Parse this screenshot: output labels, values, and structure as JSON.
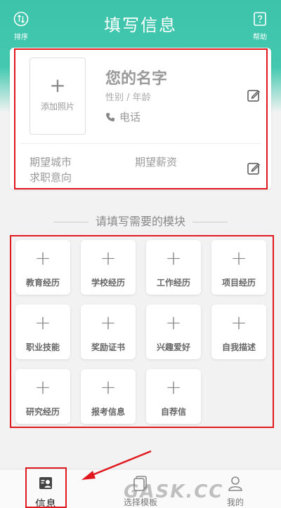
{
  "topbar": {
    "title": "填写信息",
    "sort_label": "排序",
    "help_label": "帮助"
  },
  "profile": {
    "add_photo_label": "添加照片",
    "add_photo_plus": "+",
    "name_placeholder": "您的名字",
    "gender_age": "性别 / 年龄",
    "phone_label": "电话",
    "expected_city": "期望城市",
    "expected_salary": "期望薪资",
    "job_intention": "求职意向"
  },
  "modules": {
    "section_title": "请填写需要的模块",
    "items": [
      {
        "label": "教育经历",
        "plus": "+"
      },
      {
        "label": "学校经历",
        "plus": "+"
      },
      {
        "label": "工作经历",
        "plus": "+"
      },
      {
        "label": "项目经历",
        "plus": "+"
      },
      {
        "label": "职业技能",
        "plus": "+"
      },
      {
        "label": "奖励证书",
        "plus": "+"
      },
      {
        "label": "兴趣爱好",
        "plus": "+"
      },
      {
        "label": "自我描述",
        "plus": "+"
      },
      {
        "label": "研究经历",
        "plus": "+"
      },
      {
        "label": "报考信息",
        "plus": "+"
      },
      {
        "label": "自荐信",
        "plus": "+"
      }
    ]
  },
  "tabbar": {
    "tabs": [
      {
        "label": "信息",
        "icon": "resume-icon",
        "active": true
      },
      {
        "label": "选择模板",
        "icon": "template-icon",
        "active": false
      },
      {
        "label": "我的",
        "icon": "user-icon",
        "active": false
      }
    ]
  },
  "watermark": "GASK.CC",
  "colors": {
    "accent": "#3cc3a9",
    "highlight_border": "#e0191f"
  }
}
